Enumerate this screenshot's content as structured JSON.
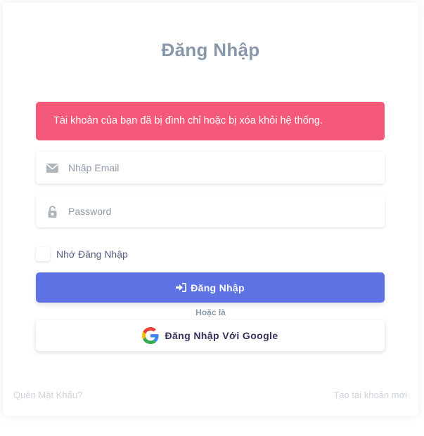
{
  "login": {
    "title": "Đăng Nhập",
    "alert_message": "Tài khoản của bạn đã bị đình chỉ hoặc bị xóa khỏi hệ thống.",
    "email_placeholder": "Nhập Email",
    "email_value": "",
    "password_placeholder": "Password",
    "password_value": "",
    "remember_label": "Nhớ Đăng Nhập",
    "submit_label": "Đăng Nhập",
    "or_label": "Hoặc là",
    "google_label": "Đăng Nhập Với Google",
    "forgot_password": "Quên Mật Khẩu?",
    "create_account": "Tạo tài khoản mới"
  },
  "icons": {
    "email": "envelope-icon",
    "password": "unlock-icon",
    "submit": "sign-in-icon",
    "google": "google-logo-icon"
  },
  "colors": {
    "alert": "#f5597a",
    "primary": "#5e72e4",
    "title": "#8898aa"
  }
}
